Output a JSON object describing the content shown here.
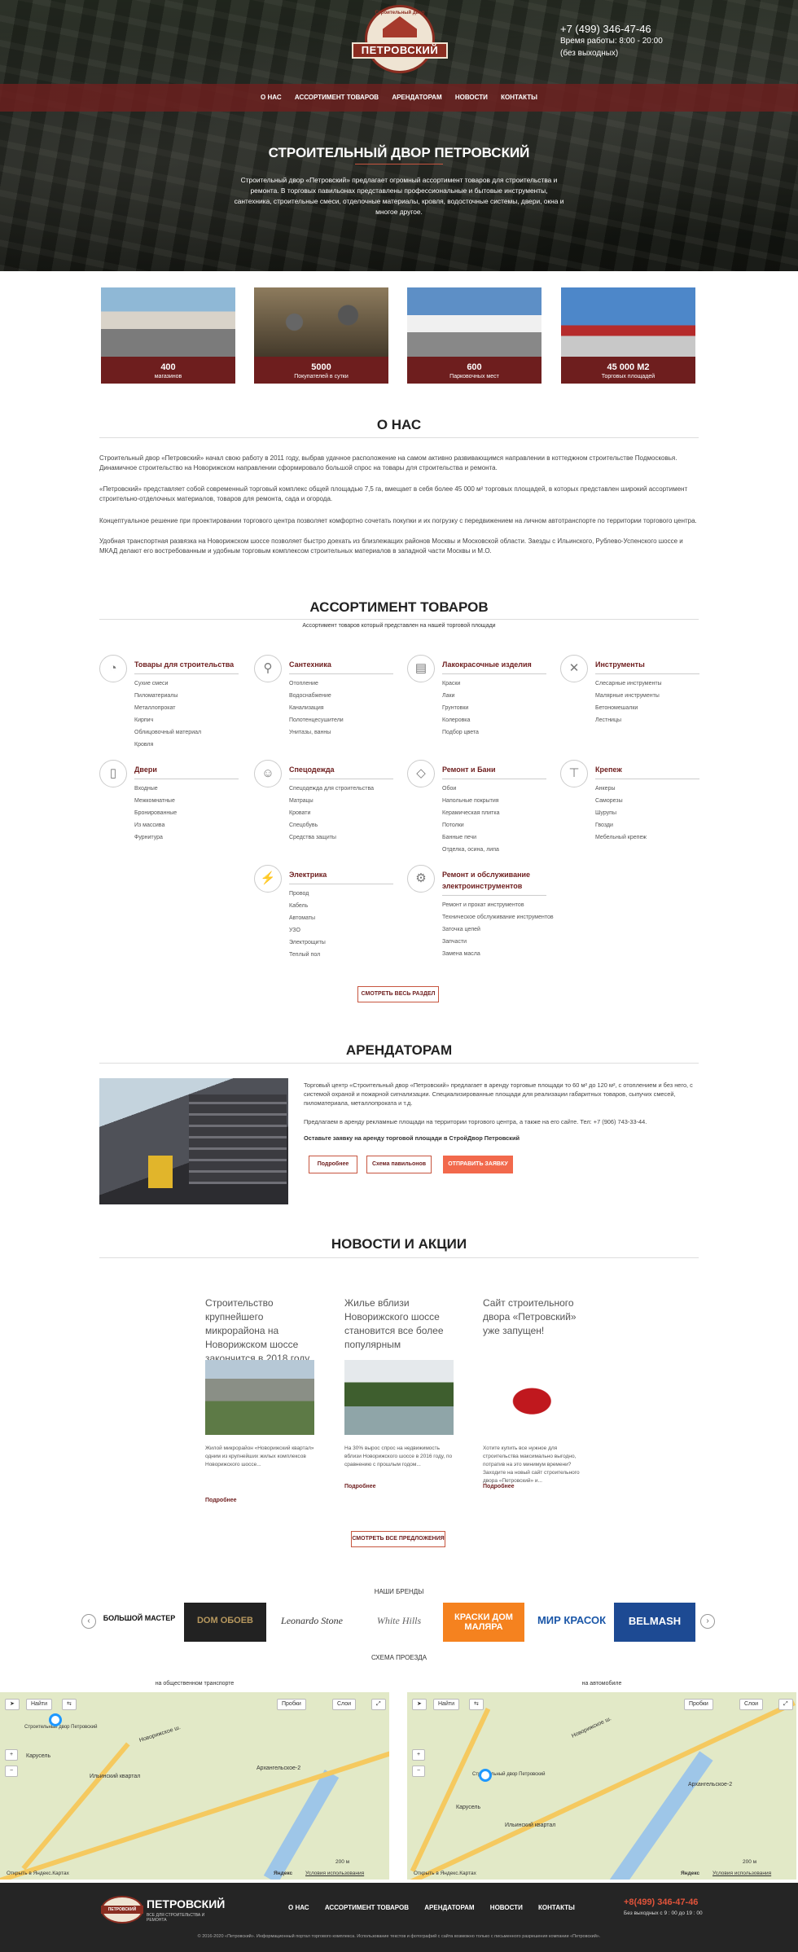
{
  "logo": {
    "arc": "Строительный двор",
    "name": "ПЕТРОВСКИЙ"
  },
  "contacts": {
    "phone": "+7 (499) 346-47-46",
    "hours": "Время работы: 8:00 - 20:00",
    "days": "(без выходных)"
  },
  "nav": [
    "О НАС",
    "АССОРТИМЕНТ ТОВАРОВ",
    "АРЕНДАТОРАМ",
    "НОВОСТИ",
    "КОНТАКТЫ"
  ],
  "hero": {
    "title": "СТРОИТЕЛЬНЫЙ ДВОР ПЕТРОВСКИЙ",
    "text": "Строительный двор «Петровский» предлагает огромный ассортимент товаров для строительства и ремонта. В торговых павильонах представлены профессиональные и бытовые инструменты, сантехника, строительные смеси, отделочные материалы, кровля, водосточные системы, двери, окна и многое другое."
  },
  "stats": [
    {
      "num": "400",
      "label": "магазинов"
    },
    {
      "num": "5000",
      "label": "Покупателей в сутки"
    },
    {
      "num": "600",
      "label": "Парковочных мест"
    },
    {
      "num": "45 000 М2",
      "label": "Торговых площадей"
    }
  ],
  "about": {
    "title": "О НАС",
    "p1": "Строительный двор «Петровский» начал свою работу в 2011 году, выбрав удачное расположение на самом активно развивающимся направлении в коттеджном строительстве Подмосковья. Динамичное строительство на Новорижском направлении сформировало большой спрос на товары для строительства и ремонта.",
    "p2": "«Петровский» представляет собой современный торговый комплекс общей площадью 7,5 га, вмещает в себя более 45 000 м² торговых площадей, в которых представлен широкий ассортимент строительно-отделочных материалов, товаров для ремонта, сада и огорода.",
    "p3": "Концептуальное решение при проектировании торгового центра позволяет комфортно сочетать покупки и их погрузку с передвижением на личном автотранспорте по территории торгового центра.",
    "p4": "Удобная  транспортная развязка на Новорижском шоссе позволяет быстро доехать из близлежащих районов Москвы и Московской области. Заезды с Ильинского, Рублево-Успенского шоссе и МКАД делают его востребованным и удобным торговым комплексом строительных материалов в западной части Москвы и М.О."
  },
  "assort": {
    "title": "АССОРТИМЕНТ ТОВАРОВ",
    "sub": "Ассортимент товаров который представлен на нашей торговой площади",
    "button": "СМОТРЕТЬ ВЕСЬ РАЗДЕЛ"
  },
  "categories": [
    {
      "name": "Товары для строительства",
      "icon": "trowel-icon",
      "glyph": "◔",
      "items": [
        "Сухие смеси",
        "Пиломатериалы",
        "Металлопрокат",
        "Кирпич",
        "Облицовочный материал",
        "Кровля"
      ]
    },
    {
      "name": "Сантехника",
      "icon": "faucet-icon",
      "glyph": "⚲",
      "items": [
        "Отопление",
        "Водоснабжение",
        "Канализация",
        "Полотенцесушители",
        "Унитазы, ванны"
      ]
    },
    {
      "name": "Лакокрасочные изделия",
      "icon": "paint-roller-icon",
      "glyph": "▤",
      "items": [
        "Краски",
        "Лаки",
        "Грунтовки",
        "Колеровка",
        "Подбор цвета"
      ]
    },
    {
      "name": "Инструменты",
      "icon": "tools-icon",
      "glyph": "✕",
      "items": [
        "Слесарные инструменты",
        "Малярные инструменты",
        "Бетономешалки",
        "Лестницы"
      ]
    },
    {
      "name": "Двери",
      "icon": "door-icon",
      "glyph": "▯",
      "items": [
        "Входные",
        "Межкомнатные",
        "Бронированные",
        "Из массива",
        "Фурнитура"
      ]
    },
    {
      "name": "Спецодежда",
      "icon": "worker-icon",
      "glyph": "☺",
      "items": [
        "Спецодежда для строительства",
        "Матрацы",
        "Кровати",
        "Спецобувь",
        "Средства защиты"
      ]
    },
    {
      "name": "Ремонт и Бани",
      "icon": "tile-icon",
      "glyph": "◇",
      "items": [
        "Обои",
        "Напольные покрытия",
        "Керамическая плитка",
        "Потолки",
        "Банные печи",
        "Отделка, осина, липа"
      ]
    },
    {
      "name": "Крепеж",
      "icon": "screw-icon",
      "glyph": "⊤",
      "items": [
        "Анкеры",
        "Саморезы",
        "Шурупы",
        "Гвозди",
        "Мебельный крепеж"
      ]
    },
    {
      "name": "Электрика",
      "icon": "bolt-icon",
      "glyph": "⚡",
      "items": [
        "Провод",
        "Кабель",
        "Автоматы",
        "УЗО",
        "Электрощиты",
        "Теплый пол"
      ]
    },
    {
      "name": "Ремонт и обслуживание электроинструментов",
      "icon": "drill-icon",
      "glyph": "⚙",
      "items": [
        "Ремонт и прокат инструментов",
        "Техническое обслуживание инструментов",
        "Заточка цепей",
        "Запчасти",
        "Замена масла"
      ]
    }
  ],
  "tenants": {
    "title": "АРЕНДАТОРАМ",
    "p1": "Торговый центр «Строительный двор «Петровский» предлагает в аренду торговые площади то 60 м² до 120 м², с отоплением и без него, с системой охраной и пожарной сигнализации. Специализированные площади для реализации габаритных товаров, сыпучих смесей, пиломатериала, металлопроката и т.д.",
    "p2": "Предлагаем в аренду рекламные площади на территории торгового центра, а также на его сайте.  Тел: +7 (906) 743-33-44.",
    "cta": "Оставьте заявку на аренду торговой площади в СтройДвор Петровский",
    "b1": "Подробнее",
    "b2": "Схема павильонов",
    "b3": "ОТПРАВИТЬ ЗАЯВКУ"
  },
  "news": {
    "title": "НОВОСТИ И АКЦИИ",
    "more": "Подробнее",
    "button": "СМОТРЕТЬ ВСЕ ПРЕДЛОЖЕНИЯ",
    "items": [
      {
        "title": "Строительство крупнейшего микрорайона на Новорижском шоссе закончится в 2018 году",
        "text": "Жилой микрорайон «Новорижский квартал» одним из крупнейших жилых комплексов Новорижского шоссе..."
      },
      {
        "title": "Жилье вблизи Новорижского шоссе становится все более популярным",
        "text": "На 30% вырос спрос на недвижимость вблизи Новорижского шоссе в 2016 году, по сравнению с прошлым годом..."
      },
      {
        "title": "Сайт строительного двора «Петровский» уже запущен!",
        "text": "Хотите купить все нужное для строительства максимально выгодно, потратив на это минимум времени? Заходите на новый сайт строительного двора «Петровский» и..."
      }
    ]
  },
  "brands": {
    "title": "НАШИ БРЕНДЫ",
    "items": [
      "БОЛЬШОЙ МАСТЕР",
      "DOM ОБОЕВ",
      "Leonardo Stone",
      "White Hills",
      "КРАСКИ ДОМ МАЛЯРА",
      "МИР КРАСОК",
      "BELMASH"
    ]
  },
  "scheme": {
    "title": "СХЕМА ПРОЕЗДА",
    "public": "на общественном транспорте",
    "auto": "на автомобиле",
    "find": "Найти",
    "traffic": "Пробки",
    "layers": "Слои",
    "open": "Открыть в Яндекс.Картах",
    "yandex": "Яндекс",
    "terms": "Условия использования",
    "scale": "200 м",
    "labels": [
      "Новорижское ш.",
      "Архангельское-2",
      "Ильинский квартал",
      "Карусель",
      "Строительный двор Петровский"
    ]
  },
  "footer": {
    "name": "ПЕТРОВСКИЙ",
    "tagline": "ВСЕ ДЛЯ СТРОИТЕЛЬСТВА И РЕМОНТА",
    "phone": "+8(499) 346-47-46",
    "hours": "Без выходных с 9 : 00 до 19 : 00",
    "copy": "© 2016-2020 «Петровский». Информационный портал торгового комплекса. Использование текстов и фотографий с сайта возможно только с письменного разрешения компании «Петровский»."
  }
}
